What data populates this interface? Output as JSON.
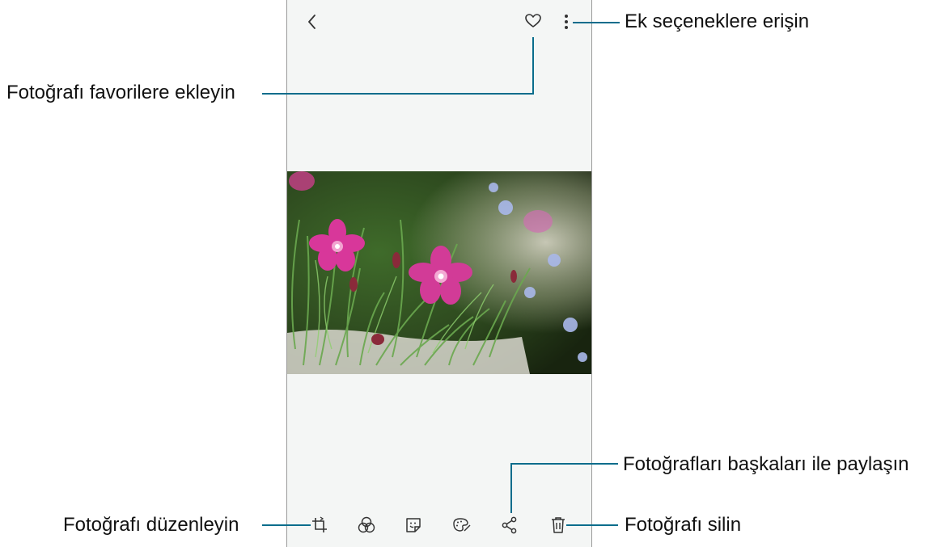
{
  "callouts": {
    "more_options": "Ek seçeneklere erişin",
    "favorite": "Fotoğrafı favorilere ekleyin",
    "share": "Fotoğrafları başkaları ile paylaşın",
    "edit": "Fotoğrafı düzenleyin",
    "delete": "Fotoğrafı silin"
  },
  "colors": {
    "callout_line": "#0a6d8c",
    "screen_bg": "#f4f6f5",
    "icon": "#333333"
  },
  "icons": {
    "top": [
      "back-icon",
      "heart-icon",
      "more-vertical-icon"
    ],
    "bottom": [
      "crop-icon",
      "filter-icon",
      "sticker-icon",
      "palette-icon",
      "share-icon",
      "trash-icon"
    ]
  }
}
